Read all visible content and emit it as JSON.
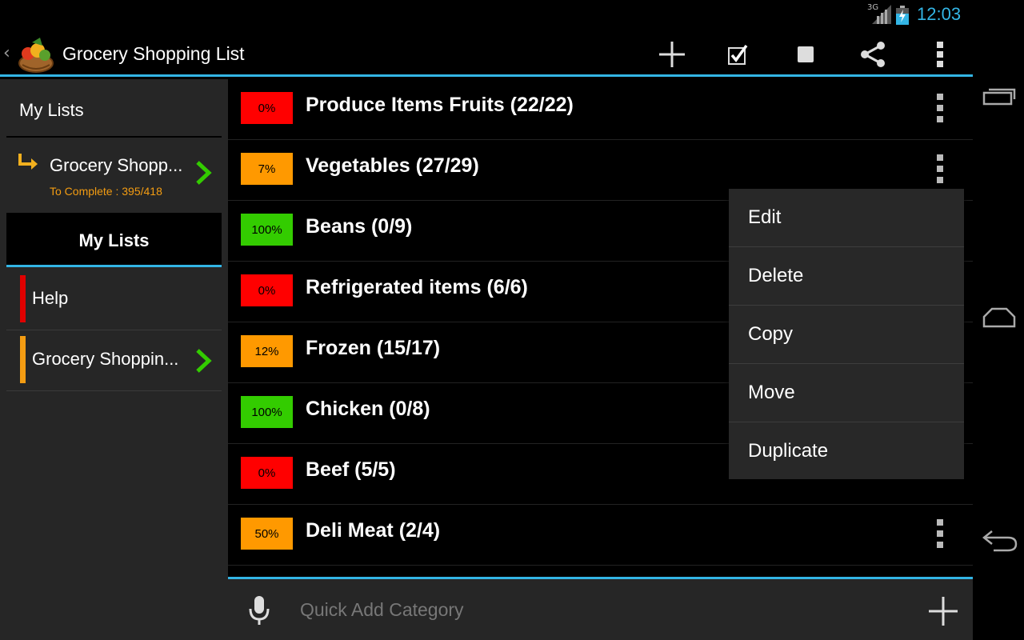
{
  "status": {
    "network": "3G",
    "time": "12:03"
  },
  "actionbar": {
    "title": "Grocery Shopping List",
    "actions": [
      "add-icon",
      "check-all-icon",
      "uncheck-all-icon",
      "share-icon",
      "overflow-icon"
    ]
  },
  "sidebar": {
    "header": "My Lists",
    "current": {
      "name": "Grocery Shopp...",
      "complete": "To Complete : 395/418"
    },
    "tab": "My Lists",
    "items": [
      {
        "label": "Help",
        "color": "#e00000"
      },
      {
        "label": "Grocery Shoppin...",
        "color": "#f39c12"
      }
    ]
  },
  "categories": [
    {
      "percent": "0%",
      "name": "Produce Items Fruits (22/22)",
      "color": "#ff0000"
    },
    {
      "percent": "7%",
      "name": "Vegetables (27/29)",
      "color": "#ff9900"
    },
    {
      "percent": "100%",
      "name": "Beans (0/9)",
      "color": "#33cc00"
    },
    {
      "percent": "0%",
      "name": "Refrigerated items (6/6)",
      "color": "#ff0000"
    },
    {
      "percent": "12%",
      "name": "Frozen (15/17)",
      "color": "#ff9900"
    },
    {
      "percent": "100%",
      "name": "Chicken (0/8)",
      "color": "#33cc00"
    },
    {
      "percent": "0%",
      "name": "Beef (5/5)",
      "color": "#ff0000"
    },
    {
      "percent": "50%",
      "name": "Deli Meat (2/4)",
      "color": "#ff9900"
    }
  ],
  "popup": {
    "items": [
      "Edit",
      "Delete",
      "Copy",
      "Move",
      "Duplicate"
    ]
  },
  "quickadd": {
    "placeholder": "Quick Add Category"
  },
  "colors": {
    "accent": "#33b5e5",
    "sidebar_bg": "#262626",
    "complete_text": "#f39c12"
  }
}
